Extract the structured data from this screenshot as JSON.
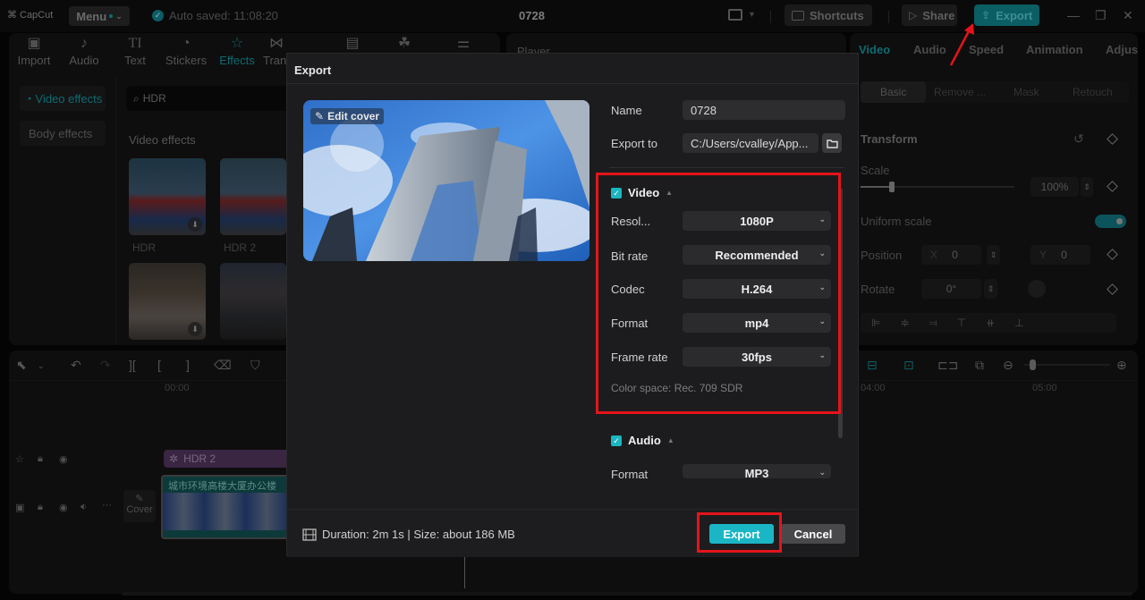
{
  "app": {
    "brand": "CapCut",
    "menu_label": "Menu",
    "autosave_text": "Auto saved: 11:08:20",
    "project_title": "0728",
    "shortcuts_label": "Shortcuts",
    "share_label": "Share",
    "export_label": "Export"
  },
  "toolbar": {
    "items": [
      {
        "label": "Import",
        "icon": "import-icon"
      },
      {
        "label": "Audio",
        "icon": "audio-icon"
      },
      {
        "label": "Text",
        "icon": "text-icon"
      },
      {
        "label": "Stickers",
        "icon": "stickers-icon"
      },
      {
        "label": "Effects",
        "icon": "effects-icon",
        "active": true
      },
      {
        "label": "Tran",
        "icon": "transitions-icon"
      }
    ]
  },
  "effects_panel": {
    "categories": [
      "Video effects",
      "Body effects"
    ],
    "search_value": "HDR",
    "section_title": "Video effects",
    "thumbnails": [
      {
        "label": "HDR"
      },
      {
        "label": "HDR 2"
      },
      {
        "label": ""
      },
      {
        "label": ""
      }
    ]
  },
  "player": {
    "label": "Player"
  },
  "inspector": {
    "tabs": [
      "Video",
      "Audio",
      "Speed",
      "Animation",
      "Adjus"
    ],
    "subtabs": [
      "Basic",
      "Remove ...",
      "Mask",
      "Retouch"
    ],
    "section": "Transform",
    "scale_label": "Scale",
    "scale_value": "100%",
    "scale_fraction": 0.2,
    "uniform_scale_label": "Uniform scale",
    "uniform_scale_on": true,
    "position_label": "Position",
    "position_x_label": "X",
    "position_x": "0",
    "position_y_label": "Y",
    "position_y": "0",
    "rotate_label": "Rotate",
    "rotate_value": "0°"
  },
  "timeline": {
    "ruler": [
      "00:00",
      "04:00",
      "05:00"
    ],
    "effect_clip_label": "HDR 2",
    "video_clip_label": "城市环境高楼大厦办公楼",
    "cover_label": "Cover"
  },
  "export_dialog": {
    "title": "Export",
    "edit_cover_label": "Edit cover",
    "name_label": "Name",
    "name_value": "0728",
    "export_to_label": "Export to",
    "export_to_value": "C:/Users/cvalley/App...",
    "video": {
      "label": "Video",
      "checked": true,
      "fields": [
        {
          "label": "Resol...",
          "value": "1080P"
        },
        {
          "label": "Bit rate",
          "value": "Recommended"
        },
        {
          "label": "Codec",
          "value": "H.264"
        },
        {
          "label": "Format",
          "value": "mp4"
        },
        {
          "label": "Frame rate",
          "value": "30fps"
        }
      ],
      "color_space": "Color space: Rec. 709 SDR"
    },
    "audio": {
      "label": "Audio",
      "checked": true,
      "fields": [
        {
          "label": "Format",
          "value": "MP3"
        }
      ]
    },
    "footer_info": "Duration: 2m 1s | Size: about 186 MB",
    "export_button": "Export",
    "cancel_button": "Cancel"
  },
  "colors": {
    "accent": "#1ab6c6",
    "annotation": "#e4141a"
  }
}
